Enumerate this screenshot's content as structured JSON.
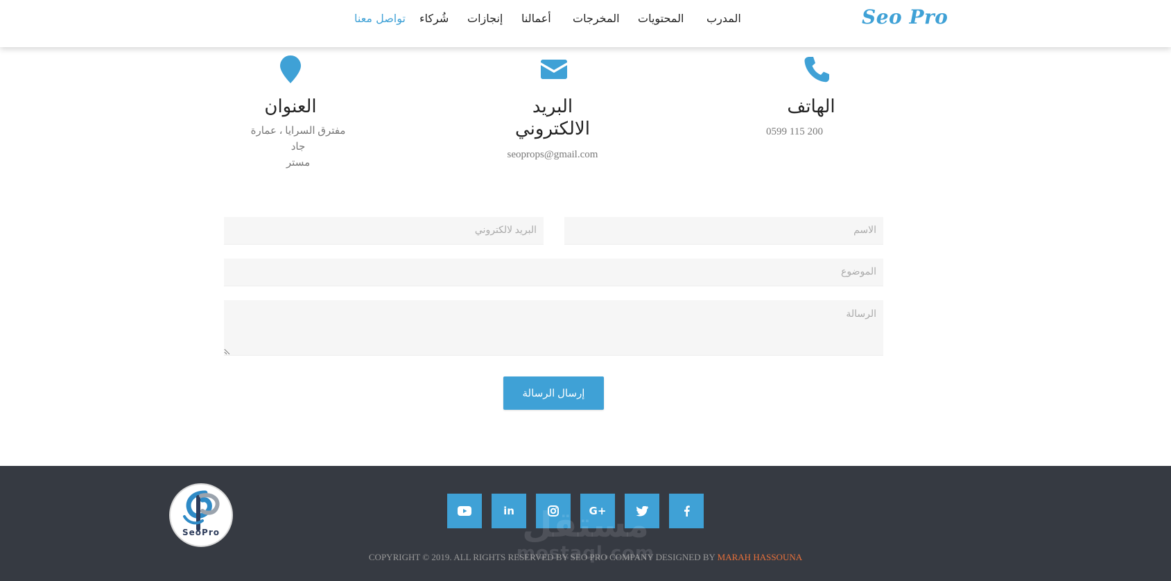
{
  "brand": {
    "name": "Seo Pro"
  },
  "nav": {
    "items": [
      {
        "label": "المدرب"
      },
      {
        "label": "المحتويات"
      },
      {
        "label": "المخرجات"
      },
      {
        "label": "أعمالنا"
      },
      {
        "label": "إنجازات"
      },
      {
        "label": "شُركاء"
      },
      {
        "label": "تواصل معنا",
        "active": true
      }
    ]
  },
  "contact": {
    "phone": {
      "title": "الهاتف",
      "value": "0599 115 200",
      "icon": "phone-icon"
    },
    "email": {
      "title_line1": "البريد",
      "title_line2": "الالكتروني",
      "value": "seoprops@gmail.com",
      "icon": "envelope-icon"
    },
    "address": {
      "title": "العنوان",
      "line1": "مفترق السرايا ، عمارة جاد",
      "line2": "مستر",
      "icon": "map-marker-icon"
    }
  },
  "form": {
    "name_placeholder": "الاسم",
    "email_placeholder": "البريد لالكتروني",
    "subject_placeholder": "الموضوع",
    "message_placeholder": "الرسالة",
    "submit_label": "إرسال الرسالة"
  },
  "footer": {
    "logo_text": "SeoPro",
    "social": [
      "facebook-icon",
      "twitter-icon",
      "google-plus-icon",
      "instagram-icon",
      "linkedin-icon",
      "youtube-icon"
    ],
    "google_plus_glyph": "G+",
    "linkedin_glyph": "in",
    "copyright_text": "COPYRIGHT © 2019. ALL RIGHTS RESERVED BY SEO PRO COMPANY DESIGNED BY",
    "designer": "MARAH HASSOUNA",
    "watermark_ar": "مستقل",
    "watermark_en": "mostaql.com"
  },
  "colors": {
    "accent": "#3fa1d6",
    "footer_bg": "#363a42",
    "designer": "#e8703a"
  }
}
